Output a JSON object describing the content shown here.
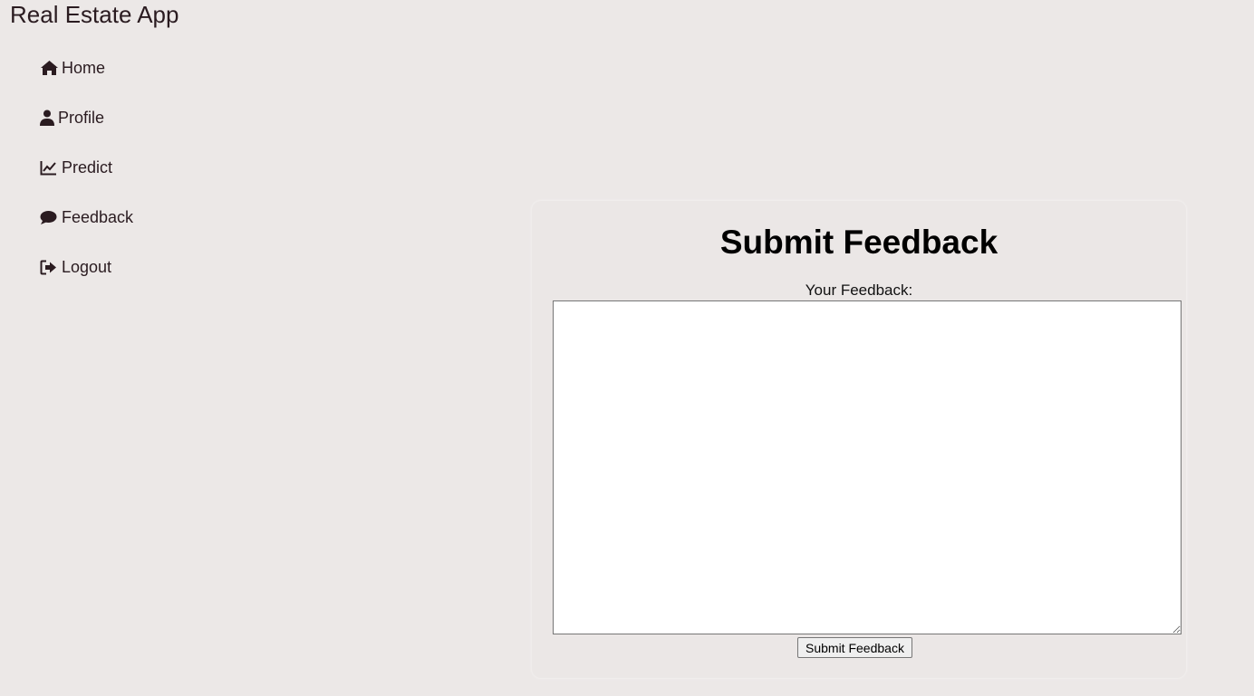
{
  "app": {
    "title": "Real Estate App"
  },
  "sidebar": {
    "items": [
      {
        "label": "Home",
        "icon": "home-icon"
      },
      {
        "label": "Profile",
        "icon": "user-icon"
      },
      {
        "label": "Predict",
        "icon": "line-chart-icon"
      },
      {
        "label": "Feedback",
        "icon": "comment-icon"
      },
      {
        "label": "Logout",
        "icon": "sign-out-icon"
      }
    ]
  },
  "feedback_form": {
    "title": "Submit Feedback",
    "label": "Your Feedback:",
    "value": "",
    "submit_label": "Submit Feedback"
  },
  "colors": {
    "background": "#ece8e7",
    "text": "#2a1b20"
  }
}
